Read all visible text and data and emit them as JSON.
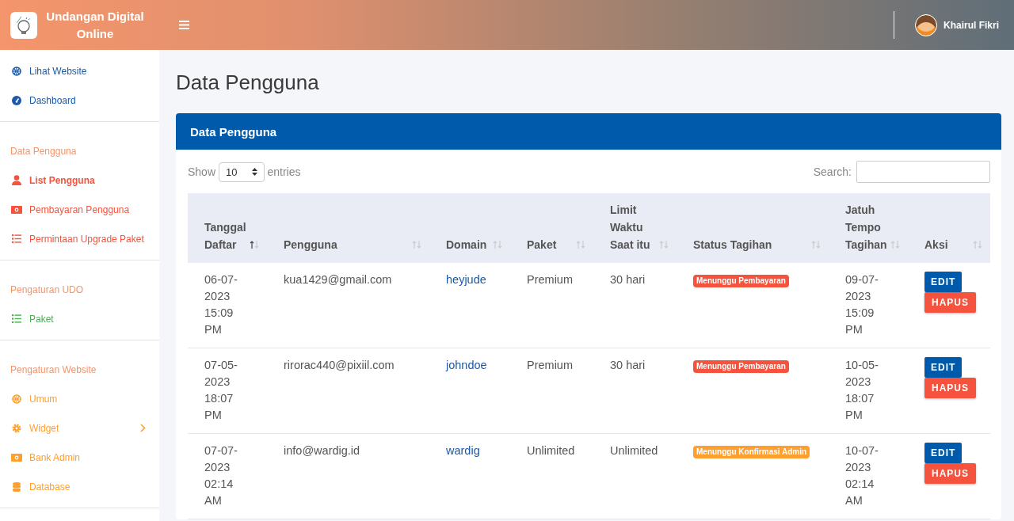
{
  "brand": {
    "title": "Undangan Digital Online"
  },
  "user": {
    "name": "Khairul Fikri"
  },
  "sidebar": {
    "sections": [
      {
        "color": "#1a5aa8",
        "items": [
          {
            "label": "Lihat Website",
            "selected": false,
            "expandable": false
          },
          {
            "label": "Dashboard",
            "selected": false,
            "expandable": false
          }
        ]
      },
      {
        "heading": "Data Pengguna",
        "color": "#f5533d",
        "items": [
          {
            "label": "List Pengguna",
            "selected": true,
            "expandable": false
          },
          {
            "label": "Pembayaran Pengguna",
            "selected": false,
            "expandable": false
          },
          {
            "label": "Permintaan Upgrade Paket",
            "selected": false,
            "expandable": false
          }
        ]
      },
      {
        "heading": "Pengaturan UDO",
        "color": "#4caf50",
        "items": [
          {
            "label": "Paket",
            "selected": false,
            "expandable": false
          }
        ]
      },
      {
        "heading": "Pengaturan Website",
        "color": "#ff9f2e",
        "items": [
          {
            "label": "Umum",
            "selected": false,
            "expandable": false
          },
          {
            "label": "Widget",
            "selected": false,
            "expandable": true
          },
          {
            "label": "Bank Admin",
            "selected": false,
            "expandable": false
          },
          {
            "label": "Database",
            "selected": false,
            "expandable": false
          }
        ]
      }
    ]
  },
  "page_title": "Data Pengguna",
  "card": {
    "title": "Data Pengguna",
    "length": {
      "before": "Show",
      "value": "10",
      "after": "entries"
    },
    "search": {
      "label": "Search:"
    },
    "columns": [
      {
        "label": "Tanggal Daftar",
        "selected": true
      },
      {
        "label": "Pengguna",
        "selected": false
      },
      {
        "label": "Domain",
        "selected": false
      },
      {
        "label": "Paket",
        "selected": false
      },
      {
        "label": "Limit Waktu Saat itu",
        "selected": false
      },
      {
        "label": "Status Tagihan",
        "selected": false
      },
      {
        "label": "Jatuh Tempo Tagihan",
        "selected": false
      },
      {
        "label": "Aksi",
        "selected": false
      }
    ],
    "rows": [
      {
        "registered": "06-07-2023 15:09 PM",
        "user": "kua1429@gmail.com",
        "domain": "heyjude",
        "package": "Premium",
        "limit": "30 hari",
        "status": {
          "text": "Menunggu Pembayaran",
          "color": "#f5533d"
        },
        "due": "09-07-2023 15:09 PM",
        "actions": [
          "EDIT",
          "HAPUS"
        ]
      },
      {
        "registered": "07-05-2023 18:07 PM",
        "user": "rirorac440@pixiil.com",
        "domain": "johndoe",
        "package": "Premium",
        "limit": "30 hari",
        "status": {
          "text": "Menunggu Pembayaran",
          "color": "#f5533d"
        },
        "due": "10-05-2023 18:07 PM",
        "actions": [
          "EDIT",
          "HAPUS"
        ]
      },
      {
        "registered": "07-07-2023 02:14 AM",
        "user": "info@wardig.id",
        "domain": "wardig",
        "package": "Unlimited",
        "limit": "Unlimited",
        "status": {
          "text": "Menunggu Konfirmasi Admin",
          "color": "#ff9f2e"
        },
        "due": "10-07-2023 02:14 AM",
        "actions": [
          "EDIT",
          "HAPUS"
        ]
      }
    ]
  }
}
